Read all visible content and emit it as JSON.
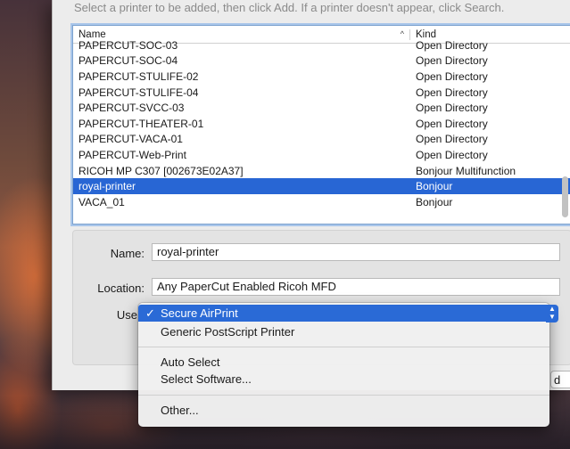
{
  "banner_text": "Select a printer to be added, then click Add. If a printer doesn't appear, click Search.",
  "list": {
    "columns": {
      "name": "Name",
      "kind": "Kind"
    },
    "rows": [
      {
        "name": "PAPERCUT-SOC-03",
        "kind": "Open Directory"
      },
      {
        "name": "PAPERCUT-SOC-04",
        "kind": "Open Directory"
      },
      {
        "name": "PAPERCUT-STULIFE-02",
        "kind": "Open Directory"
      },
      {
        "name": "PAPERCUT-STULIFE-04",
        "kind": "Open Directory"
      },
      {
        "name": "PAPERCUT-SVCC-03",
        "kind": "Open Directory"
      },
      {
        "name": "PAPERCUT-THEATER-01",
        "kind": "Open Directory"
      },
      {
        "name": "PAPERCUT-VACA-01",
        "kind": "Open Directory"
      },
      {
        "name": "PAPERCUT-Web-Print",
        "kind": "Open Directory"
      },
      {
        "name": "RICOH MP C307 [002673E02A37]",
        "kind": "Bonjour Multifunction"
      },
      {
        "name": "royal-printer",
        "kind": "Bonjour"
      },
      {
        "name": "VACA_01",
        "kind": "Bonjour"
      }
    ],
    "selected_index": 9
  },
  "details": {
    "name_label": "Name:",
    "name_value": "royal-printer",
    "location_label": "Location:",
    "location_value": "Any PaperCut Enabled Ricoh MFD",
    "use_label": "Use"
  },
  "use_menu": {
    "items": [
      {
        "label": "Secure AirPrint",
        "checked": true
      },
      {
        "label": "Generic PostScript Printer"
      },
      {
        "label": "Auto Select"
      },
      {
        "label": "Select Software..."
      },
      {
        "label": "Other..."
      }
    ],
    "check_glyph": "✓"
  },
  "peek_button_text": "d",
  "colors": {
    "selection": "#2866d4",
    "menu_highlight": "#2a6ad6"
  }
}
